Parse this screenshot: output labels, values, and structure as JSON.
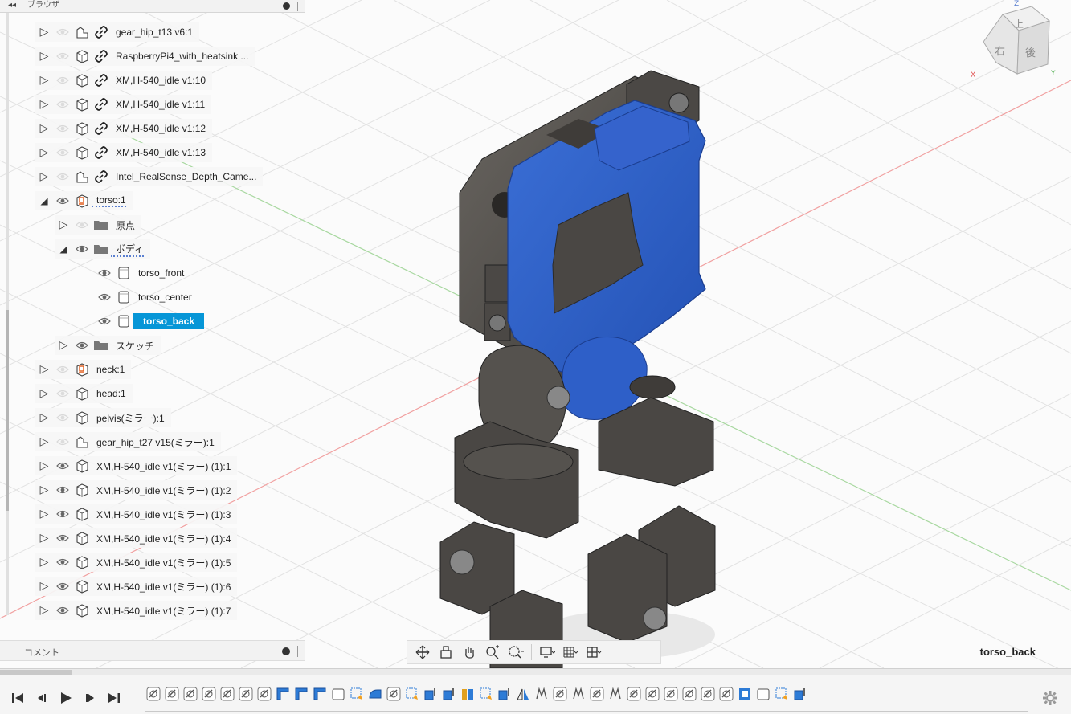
{
  "browser": {
    "title": "ブラウザ",
    "collapse_glyph": "◂◂"
  },
  "tree": [
    {
      "label": "gear_hip_t13 v6:1",
      "indent": 0,
      "expanded": false,
      "visible": false,
      "type": "component-ref",
      "linked": true
    },
    {
      "label": "RaspberryPi4_with_heatsink ...",
      "indent": 0,
      "expanded": false,
      "visible": false,
      "type": "component",
      "linked": true
    },
    {
      "label": "XM,H-540_idle v1:10",
      "indent": 0,
      "expanded": false,
      "visible": false,
      "type": "component",
      "linked": true
    },
    {
      "label": "XM,H-540_idle v1:11",
      "indent": 0,
      "expanded": false,
      "visible": false,
      "type": "component",
      "linked": true
    },
    {
      "label": "XM,H-540_idle v1:12",
      "indent": 0,
      "expanded": false,
      "visible": false,
      "type": "component",
      "linked": true
    },
    {
      "label": "XM,H-540_idle v1:13",
      "indent": 0,
      "expanded": false,
      "visible": false,
      "type": "component",
      "linked": true
    },
    {
      "label": "Intel_RealSense_Depth_Came...",
      "indent": 0,
      "expanded": false,
      "visible": false,
      "type": "component-ref",
      "linked": true
    },
    {
      "label": "torso:1",
      "indent": 0,
      "expanded": true,
      "visible": true,
      "type": "component-active",
      "linked": false
    },
    {
      "label": "原点",
      "indent": 1,
      "expanded": false,
      "visible": false,
      "type": "folder",
      "linked": false
    },
    {
      "label": "ボディ",
      "indent": 1,
      "expanded": true,
      "visible": true,
      "type": "folder",
      "linked": false
    },
    {
      "label": "torso_front",
      "indent": 2,
      "expanded": null,
      "visible": true,
      "type": "body",
      "linked": false
    },
    {
      "label": "torso_center",
      "indent": 2,
      "expanded": null,
      "visible": true,
      "type": "body",
      "linked": false
    },
    {
      "label": "torso_back",
      "indent": 2,
      "expanded": null,
      "visible": true,
      "type": "body",
      "linked": false,
      "selected": true
    },
    {
      "label": "スケッチ",
      "indent": 1,
      "expanded": false,
      "visible": true,
      "type": "folder",
      "linked": false
    },
    {
      "label": "neck:1",
      "indent": 0,
      "expanded": false,
      "visible": false,
      "type": "component-active",
      "linked": false
    },
    {
      "label": "head:1",
      "indent": 0,
      "expanded": false,
      "visible": false,
      "type": "component",
      "linked": false
    },
    {
      "label": "pelvis(ミラー):1",
      "indent": 0,
      "expanded": false,
      "visible": false,
      "type": "component",
      "linked": false
    },
    {
      "label": "gear_hip_t27 v15(ミラー):1",
      "indent": 0,
      "expanded": false,
      "visible": false,
      "type": "component-ref",
      "linked": false
    },
    {
      "label": "XM,H-540_idle v1(ミラー) (1):1",
      "indent": 0,
      "expanded": false,
      "visible": true,
      "type": "component",
      "linked": false
    },
    {
      "label": "XM,H-540_idle v1(ミラー) (1):2",
      "indent": 0,
      "expanded": false,
      "visible": true,
      "type": "component",
      "linked": false
    },
    {
      "label": "XM,H-540_idle v1(ミラー) (1):3",
      "indent": 0,
      "expanded": false,
      "visible": true,
      "type": "component",
      "linked": false
    },
    {
      "label": "XM,H-540_idle v1(ミラー) (1):4",
      "indent": 0,
      "expanded": false,
      "visible": true,
      "type": "component",
      "linked": false
    },
    {
      "label": "XM,H-540_idle v1(ミラー) (1):5",
      "indent": 0,
      "expanded": false,
      "visible": true,
      "type": "component",
      "linked": false
    },
    {
      "label": "XM,H-540_idle v1(ミラー) (1):6",
      "indent": 0,
      "expanded": false,
      "visible": true,
      "type": "component",
      "linked": false
    },
    {
      "label": "XM,H-540_idle v1(ミラー) (1):7",
      "indent": 0,
      "expanded": false,
      "visible": true,
      "type": "component",
      "linked": false
    }
  ],
  "comments": {
    "title": "コメント"
  },
  "viewcube": {
    "top": "上",
    "right": "右",
    "back": "後",
    "axis_x": "X",
    "axis_y": "Y",
    "axis_z": "Z"
  },
  "navbar": {
    "icons": [
      "orbit-icon",
      "look-at-icon",
      "pan-icon",
      "zoom-icon",
      "fit-icon",
      "display-settings-icon",
      "grid-settings-icon",
      "viewports-icon"
    ]
  },
  "active_body": "torso_back",
  "timeline": {
    "playback": [
      "skip-to-start-icon",
      "step-back-icon",
      "play-icon",
      "step-forward-icon",
      "skip-to-end-icon"
    ],
    "feature_count": 36
  },
  "colors": {
    "accent": "#0696d7",
    "highlight_body": "#2b5cc4",
    "part": "#4a4744"
  }
}
